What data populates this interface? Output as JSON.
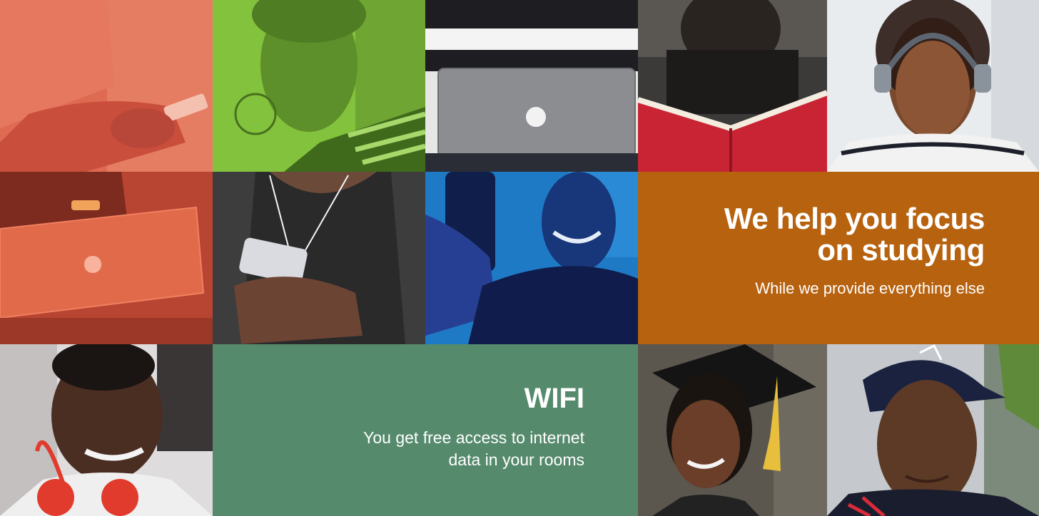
{
  "panels": {
    "focus": {
      "heading_line1": "We help you focus",
      "heading_line2": "on studying",
      "subheading": "While we provide everything else",
      "background": "#b7620f"
    },
    "wifi": {
      "heading": "WIFI",
      "description_line1": "You get free access to internet",
      "description_line2": "data in your rooms",
      "background": "#568a6c"
    }
  },
  "photos": [
    {
      "subject": "student-texting-phone",
      "tint": "#e4624c"
    },
    {
      "subject": "student-with-hoop-earrings",
      "tint": "#7fc03a"
    },
    {
      "subject": "student-with-laptop",
      "tint": "none"
    },
    {
      "subject": "student-reading-red-book",
      "tint": "none"
    },
    {
      "subject": "student-with-headphones",
      "tint": "none"
    },
    {
      "subject": "student-with-laptop-red",
      "tint": "#e0583b"
    },
    {
      "subject": "student-with-earphones-phone",
      "tint": "none"
    },
    {
      "subject": "student-taking-selfie",
      "tint": "#1f78c8"
    },
    {
      "subject": "student-with-red-headphones",
      "tint": "none"
    },
    {
      "subject": "graduate-with-cap-tassel",
      "tint": "none"
    },
    {
      "subject": "student-with-cap",
      "tint": "none"
    }
  ]
}
